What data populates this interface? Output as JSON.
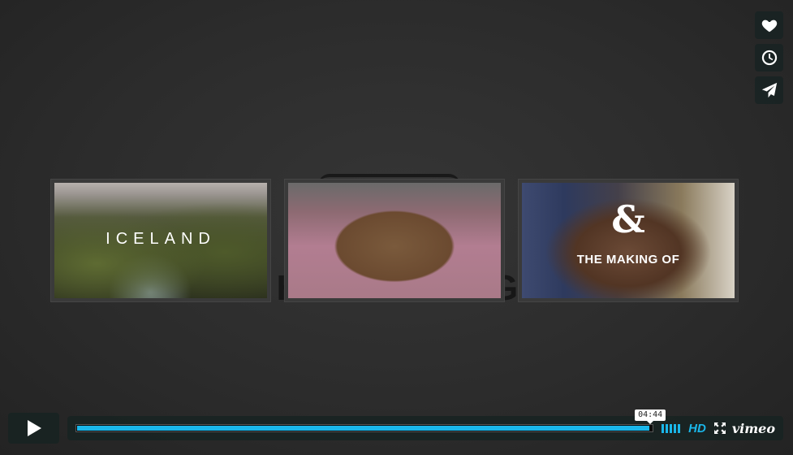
{
  "background": {
    "title_fragment": "G H O T H I S G O I N"
  },
  "side_actions": {
    "like": "heart-icon",
    "watch_later": "clock-icon",
    "share": "paper-plane-icon"
  },
  "related_videos": [
    {
      "label": "ICELAND"
    },
    {
      "label": ""
    },
    {
      "mark": "&",
      "label": "THE MAKING OF"
    }
  ],
  "controls": {
    "play": "play-icon",
    "time_tooltip": "04:44",
    "progress_fraction": 0.995,
    "hd_label": "HD",
    "fullscreen": "fullscreen-icon",
    "brand": "vimeo"
  },
  "colors": {
    "accent": "#1ab7ea",
    "control_bg": "#172322"
  }
}
